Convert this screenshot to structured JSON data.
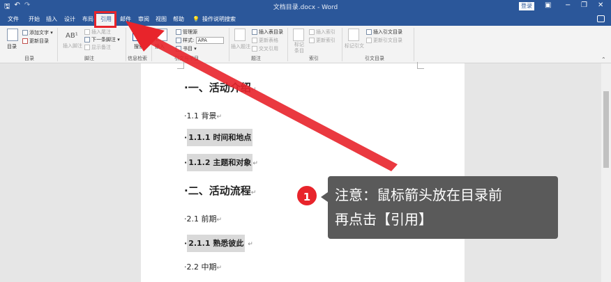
{
  "titlebar": {
    "qat_save": "🖫",
    "qat_undo": "↶",
    "qat_redo": "↷",
    "title": "文档目录.docx - Word",
    "login": "登录",
    "ribbon_display": "▣",
    "minimize": "−",
    "restore": "❐",
    "close": "✕"
  },
  "menu": {
    "tabs": [
      "文件",
      "开始",
      "插入",
      "设计",
      "布局",
      "引用",
      "邮件",
      "审阅",
      "视图",
      "帮助"
    ],
    "active_tab": "引用",
    "search_label": "操作说明搜索"
  },
  "ribbon": {
    "toc": {
      "big_label": "目录",
      "add_text": "添加文字",
      "update": "更新目录",
      "group": "目录"
    },
    "footnotes": {
      "insert": "插入脚注",
      "insert_endnote": "插入尾注",
      "next": "下一条脚注",
      "show": "显示备注",
      "group": "脚注",
      "ab_glyph": "AB¹"
    },
    "research": {
      "search": "搜索",
      "group": "信息检索"
    },
    "citations": {
      "insert": "插入",
      "manage": "管理源",
      "style_label": "样式:",
      "style_value": "APA",
      "bibliography": "书目",
      "group": "引文与书目"
    },
    "captions": {
      "insert": "插入题注",
      "insert_table": "插入表目录",
      "update_table": "更新表格",
      "cross_ref": "交叉引用",
      "group": "题注"
    },
    "index": {
      "mark": "标记",
      "mark2": "条目",
      "insert": "插入索引",
      "update": "更新索引",
      "group": "索引"
    },
    "toa": {
      "mark": "标记引文",
      "insert": "插入引文目录",
      "update": "更新引文目录",
      "group": "引文目录"
    }
  },
  "document": {
    "paragraph_mark": "↵",
    "h1": "一、活动介绍",
    "p1": "1.1 背景",
    "p2": "1.1.1 时间和地点",
    "p3": "1.1.2 主题和对象",
    "h2": "二、活动流程",
    "p4": "2.1 前期",
    "p5": "2.1.1 熟悉彼此",
    "p6": "2.2 中期"
  },
  "annotation": {
    "step_number": "1",
    "line1": "注意：鼠标箭头放在目录前",
    "line2": "再点击【引用】",
    "arrow_color": "#e8242b"
  }
}
